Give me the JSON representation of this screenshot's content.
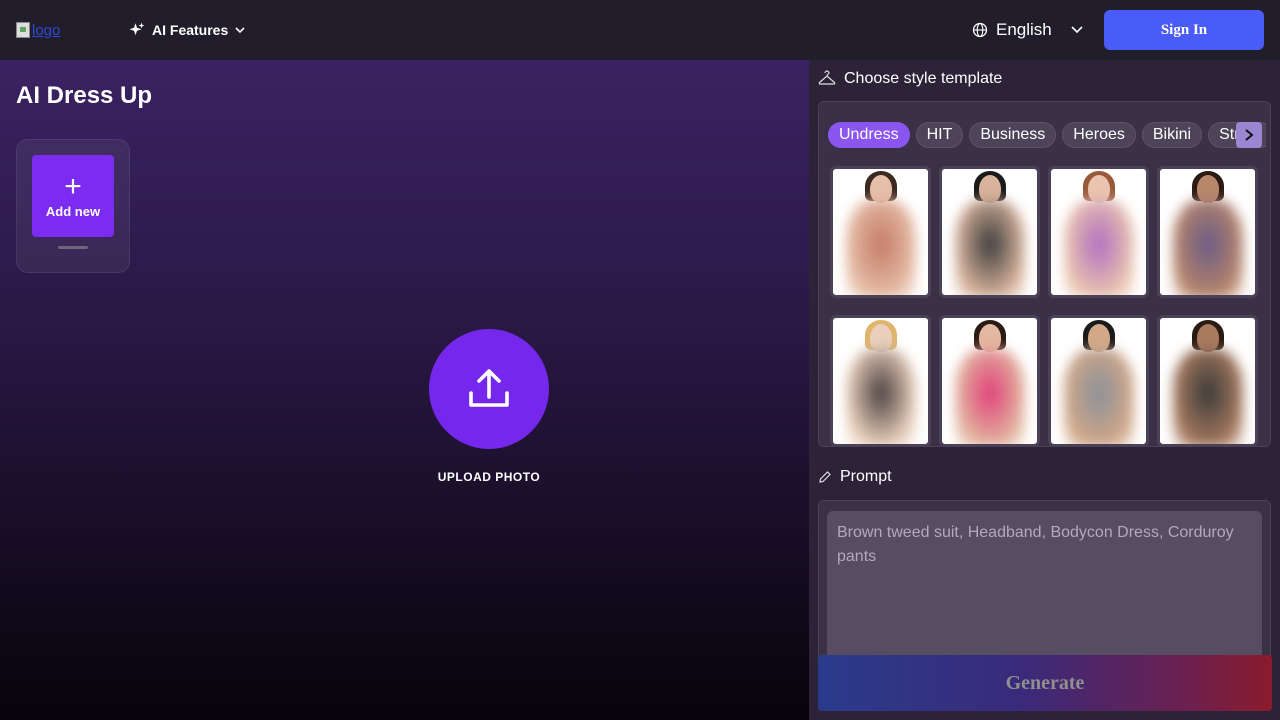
{
  "header": {
    "logo_alt": "logo",
    "ai_features_label": "AI Features",
    "language": "English",
    "signin_label": "Sign In"
  },
  "main": {
    "title": "AI Dress Up",
    "add_new_label": "Add new",
    "upload_label": "UPLOAD PHOTO"
  },
  "templates": {
    "heading": "Choose style template",
    "tabs": [
      "Undress",
      "HIT",
      "Business",
      "Heroes",
      "Bikini",
      "Street"
    ],
    "active_tab": "Undress",
    "cards": [
      {
        "hair": "#3a2a22",
        "skin": "#e6bfa8",
        "outfit": "#c47a66"
      },
      {
        "hair": "#1a1a1a",
        "skin": "#d9b39c",
        "outfit": "#3c3c3c"
      },
      {
        "hair": "#9a5a3a",
        "skin": "#eac4ae",
        "outfit": "#b06fc2"
      },
      {
        "hair": "#2a1a14",
        "skin": "#b8866a",
        "outfit": "#6a5a86"
      },
      {
        "hair": "#e0b46a",
        "skin": "#ead0bc",
        "outfit": "#4a4040"
      },
      {
        "hair": "#2a1a14",
        "skin": "#e2b8a0",
        "outfit": "#e0407a"
      },
      {
        "hair": "#1a1a1a",
        "skin": "#d2a888",
        "outfit": "#8a9098"
      },
      {
        "hair": "#2a1a14",
        "skin": "#a87a5e",
        "outfit": "#3a3a3a"
      }
    ]
  },
  "prompt": {
    "heading": "Prompt",
    "placeholder": "Brown tweed suit, Headband, Bodycon Dress, Corduroy pants"
  },
  "generate_label": "Generate",
  "colors": {
    "accent": "#7528ec",
    "signin": "#4a5cf7",
    "active_tab": "#8b55f0"
  }
}
